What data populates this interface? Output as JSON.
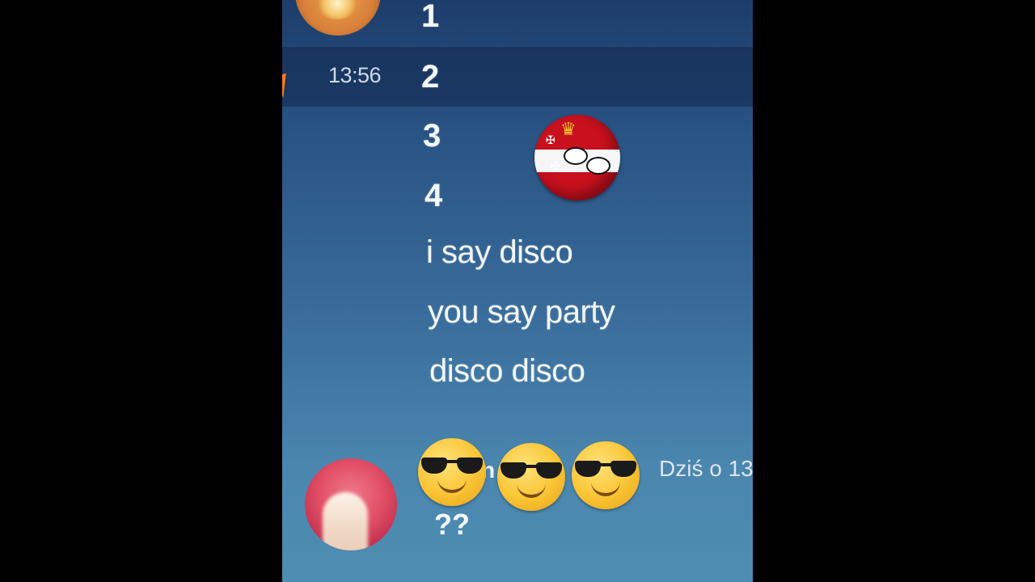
{
  "chat": {
    "hovered_timestamp": "13:56",
    "messages": [
      "1",
      "2",
      "3",
      "4",
      "i say disco",
      "you say party",
      "disco disco"
    ],
    "next_author": {
      "name_partial": "n",
      "date_label": "Dziś o 13"
    },
    "next_message": "??"
  },
  "icons": {
    "cursor": "mouse-pointer-icon",
    "top_avatar": "coat-of-arms-avatar",
    "sticker": "polish-lithuanian-countryball-sticker",
    "emoji": "sunglasses-face-emoji",
    "bottom_avatar": "user-avatar"
  },
  "colors": {
    "background_top": "#1d3d6c",
    "background_bottom": "#4f8db2",
    "text": "#f3f6fb",
    "cursor": "#ff7a1a"
  }
}
